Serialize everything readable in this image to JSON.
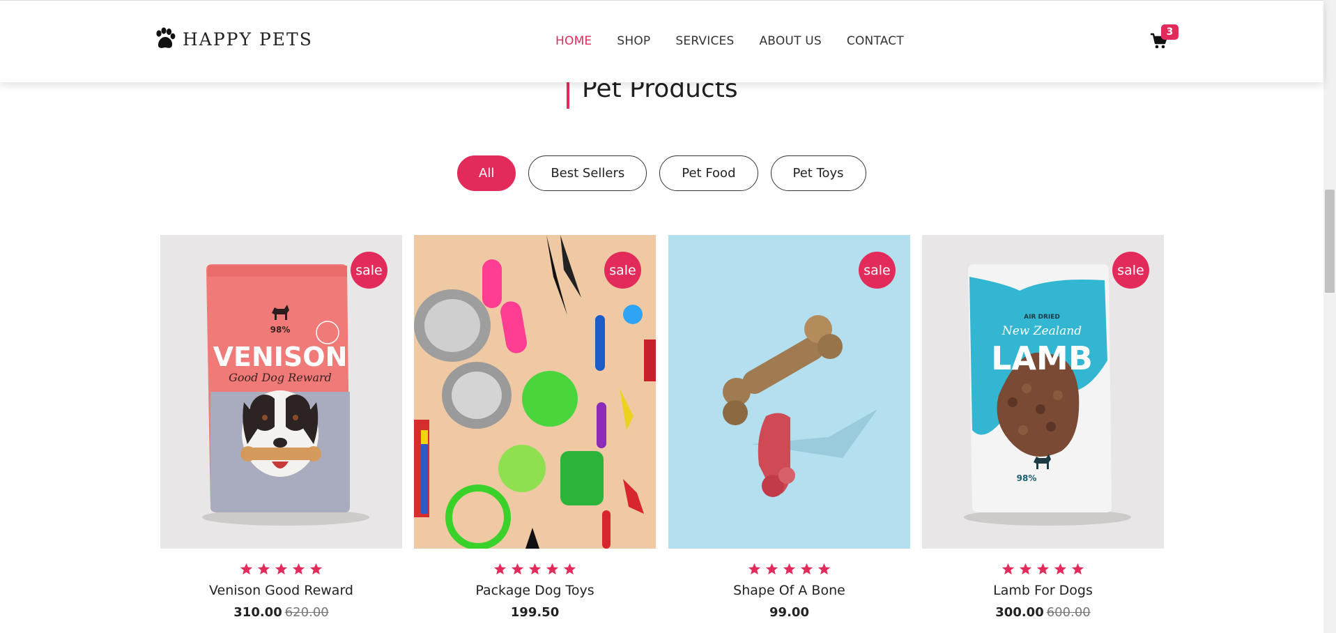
{
  "brand": {
    "name": "HAPPY PETS",
    "logo_icon": "paw-icon"
  },
  "nav": {
    "items": [
      {
        "label": "HOME",
        "active": true
      },
      {
        "label": "SHOP",
        "active": false
      },
      {
        "label": "SERVICES",
        "active": false
      },
      {
        "label": "ABOUT US",
        "active": false
      },
      {
        "label": "CONTACT",
        "active": false
      }
    ]
  },
  "cart": {
    "icon": "cart-icon",
    "count": "3"
  },
  "section": {
    "title": "Pet Products"
  },
  "filters": [
    {
      "label": "All",
      "active": true
    },
    {
      "label": "Best Sellers",
      "active": false
    },
    {
      "label": "Pet Food",
      "active": false
    },
    {
      "label": "Pet Toys",
      "active": false
    }
  ],
  "products": [
    {
      "name": "Venison Good Reward",
      "price": "310.00",
      "old_price": "620.00",
      "badge": "sale",
      "rating": 5
    },
    {
      "name": "Package Dog Toys",
      "price": "199.50",
      "old_price": "",
      "badge": "sale",
      "rating": 5
    },
    {
      "name": "Shape Of A Bone",
      "price": "99.00",
      "old_price": "",
      "badge": "sale",
      "rating": 5
    },
    {
      "name": "Lamb For Dogs",
      "price": "300.00",
      "old_price": "600.00",
      "badge": "sale",
      "rating": 5
    }
  ],
  "product_image_text": {
    "venison": {
      "line1": "98%",
      "title": "VENISON",
      "subtitle": "Good Dog Reward"
    },
    "lamb": {
      "top": "AIR DRIED",
      "script": "New Zealand",
      "title": "LAMB",
      "line1": "98%"
    }
  },
  "colors": {
    "accent": "#e32b5b"
  }
}
